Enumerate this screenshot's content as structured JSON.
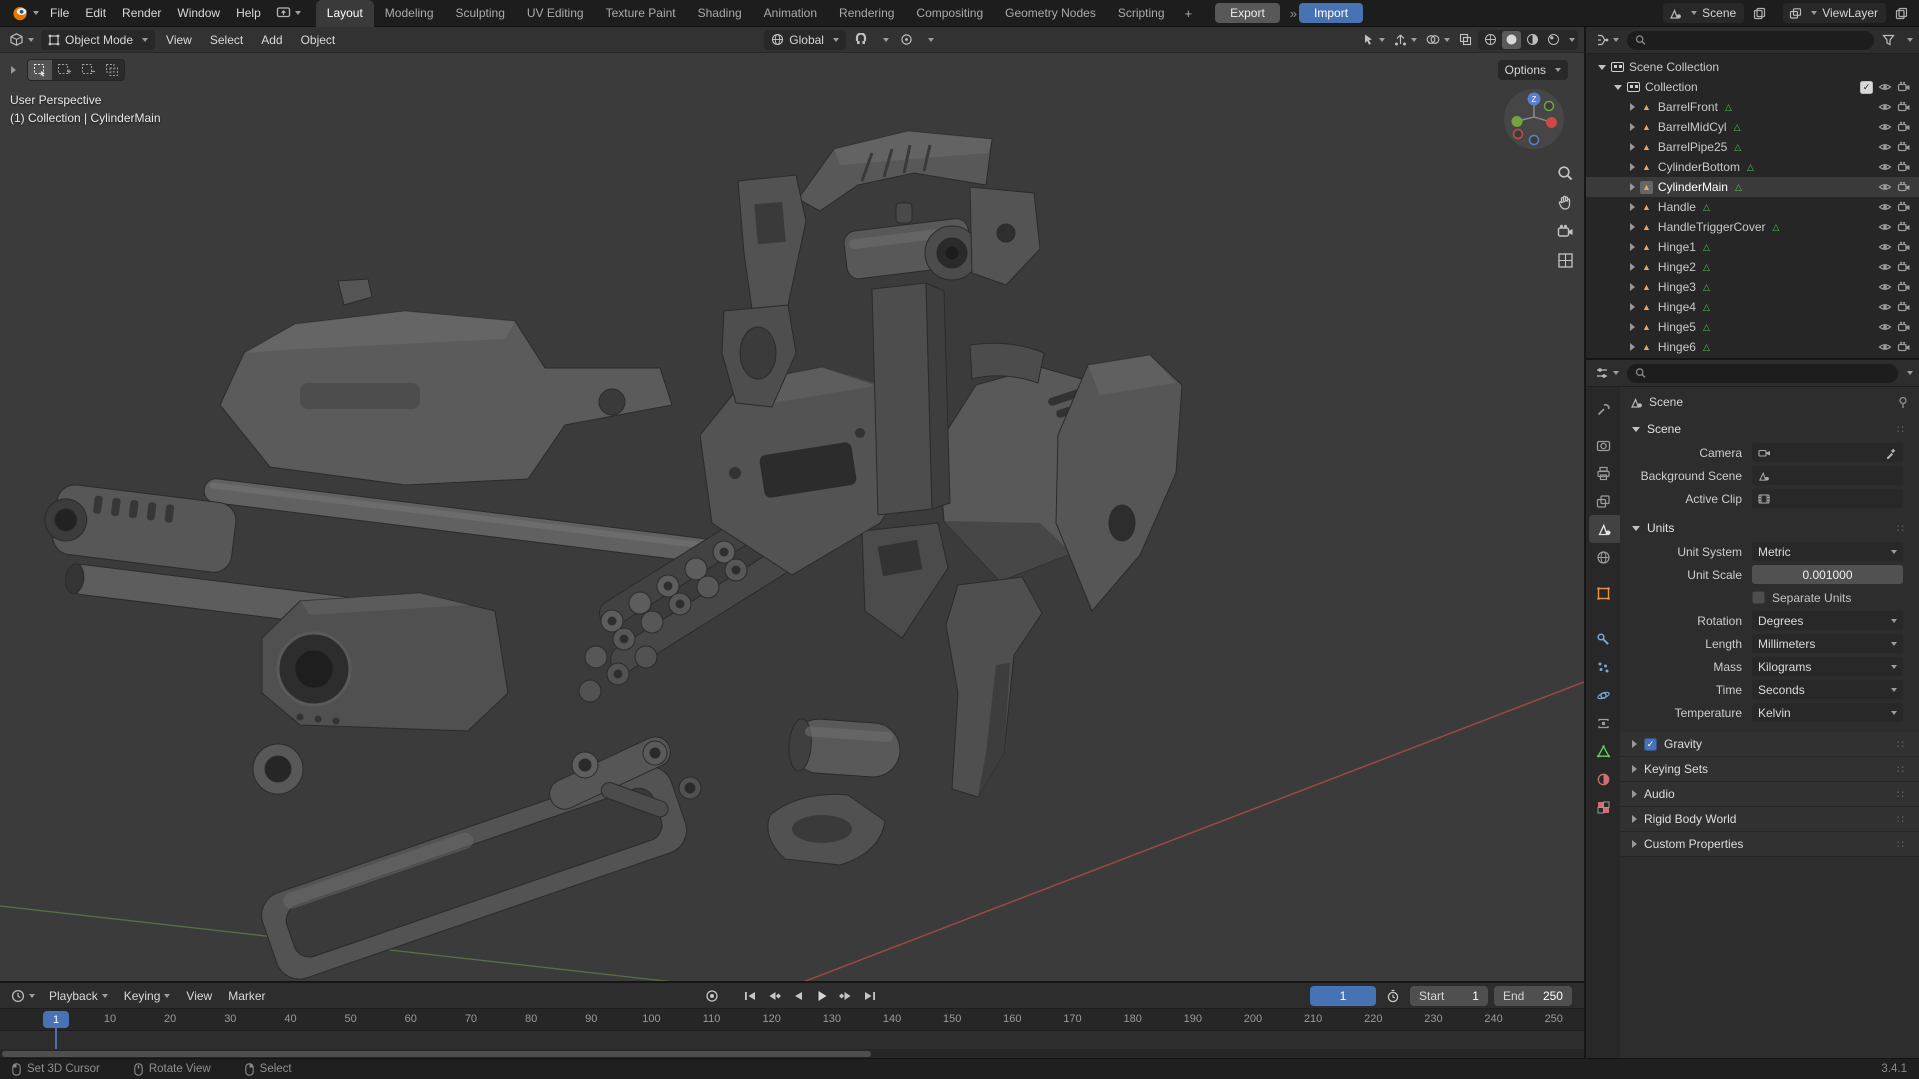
{
  "topbar": {
    "menus": [
      "File",
      "Edit",
      "Render",
      "Window",
      "Help"
    ],
    "workspaces": [
      "Layout",
      "Modeling",
      "Sculpting",
      "UV Editing",
      "Texture Paint",
      "Shading",
      "Animation",
      "Rendering",
      "Compositing",
      "Geometry Nodes",
      "Scripting"
    ],
    "active_workspace": "Layout",
    "new_workspace_label": "+",
    "export_label": "Export",
    "import_label": "Import",
    "scene": {
      "label": "Scene"
    },
    "view_layer": {
      "label": "ViewLayer"
    }
  },
  "viewport": {
    "header": {
      "mode": "Object Mode",
      "menus": [
        "View",
        "Select",
        "Add",
        "Object"
      ],
      "orientation": "Global",
      "options_label": "Options"
    },
    "overlay": {
      "perspective": "User Perspective",
      "context": "(1) Collection | CylinderMain"
    },
    "gizmo": {
      "z_label": "Z"
    }
  },
  "outliner": {
    "root_label": "Scene Collection",
    "collection_label": "Collection",
    "objects": [
      "BarrelFront",
      "BarrelMidCyl",
      "BarrelPipe25",
      "CylinderBottom",
      "CylinderMain",
      "Handle",
      "HandleTriggerCover",
      "Hinge1",
      "Hinge2",
      "Hinge3",
      "Hinge4",
      "Hinge5",
      "Hinge6"
    ],
    "active_object": "CylinderMain"
  },
  "properties": {
    "breadcrumb": "Scene",
    "scene_panel": {
      "title": "Scene",
      "camera_label": "Camera",
      "background_scene_label": "Background Scene",
      "active_clip_label": "Active Clip"
    },
    "units_panel": {
      "title": "Units",
      "unit_system_label": "Unit System",
      "unit_system": "Metric",
      "unit_scale_label": "Unit Scale",
      "unit_scale": "0.001000",
      "separate_units_label": "Separate Units",
      "rotation_label": "Rotation",
      "rotation": "Degrees",
      "length_label": "Length",
      "length": "Millimeters",
      "mass_label": "Mass",
      "mass": "Kilograms",
      "time_label": "Time",
      "time": "Seconds",
      "temperature_label": "Temperature",
      "temperature": "Kelvin"
    },
    "collapsed_panels": [
      "Gravity",
      "Keying Sets",
      "Audio",
      "Rigid Body World",
      "Custom Properties"
    ]
  },
  "timeline": {
    "menus": [
      "Playback",
      "Keying",
      "View",
      "Marker"
    ],
    "current_frame": "1",
    "playhead_frame": "1",
    "start_label": "Start",
    "start_frame": "1",
    "end_label": "End",
    "end_frame": "250",
    "ticks": [
      "10",
      "20",
      "30",
      "40",
      "50",
      "60",
      "70",
      "80",
      "90",
      "100",
      "110",
      "120",
      "130",
      "140",
      "150",
      "160",
      "170",
      "180",
      "190",
      "200",
      "210",
      "220",
      "230",
      "240",
      "250"
    ]
  },
  "statusbar": {
    "hints": [
      "Set 3D Cursor",
      "Rotate View",
      "Select"
    ],
    "version": "3.4.1"
  },
  "icons": {
    "mesh_object": "▲",
    "mesh_data": "△",
    "drag_handle": "∷",
    "import_chevrons": "»"
  },
  "colors": {
    "accent": "#4772b3",
    "object_orange": "#eda35c",
    "data_green": "#54c154",
    "axis_red": "#b04a48",
    "axis_green": "#607c4e"
  }
}
